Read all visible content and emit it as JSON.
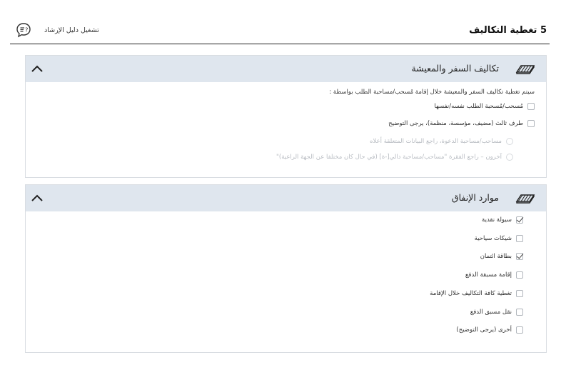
{
  "header": {
    "step_title": "5 تغطية التكاليف",
    "guide_label": "تشغيل دليل الإرشاد",
    "guide_icon": "chat-question-icon"
  },
  "travel_panel": {
    "title": "تكاليف السفر والمعيشة",
    "icon": "money-stack-icon",
    "intro": "سيتم تغطية تكاليف السفر والمعيشة خلال إقامة مُسحب/مساحبة الطلب بواسطة :",
    "options": [
      {
        "label": "مُسحب/مُسحبة الطلب نفسه/نفسها",
        "checked": false
      },
      {
        "label": "طرف ثالث (مضيف، مؤسسة، منظمة)، يرجى التوضيح",
        "checked": false
      }
    ],
    "sub_options": [
      {
        "label": "مساحب/مساحبة الدعوة، راجع البيانات المتعلقة أعلاه",
        "disabled": true
      },
      {
        "label": "آخرون – راجع الفقرة \"مساحب/مساحبة دالي[-ة] (في حال كان مختلفا عن الجهة الراعية)\"",
        "disabled": true
      }
    ]
  },
  "means_panel": {
    "title": "موارد الإنفاق",
    "icon": "money-stack-icon",
    "options": [
      {
        "label": "سيولة نقدية",
        "checked": true
      },
      {
        "label": "شيكات سياحية",
        "checked": false
      },
      {
        "label": "بطاقة ائتمان",
        "checked": true
      },
      {
        "label": "إقامة مسبقة الدفع",
        "checked": false
      },
      {
        "label": "تغطية كافة التكاليف خلال الإقامة",
        "checked": false
      },
      {
        "label": "نقل مسبق الدفع",
        "checked": false
      },
      {
        "label": "أخرى (يرجى التوضيح)",
        "checked": false
      }
    ]
  },
  "colors": {
    "panel_header_bg": "#dfe6ee",
    "panel_border": "#d9dde2",
    "disabled_text": "#b8bcc2"
  }
}
